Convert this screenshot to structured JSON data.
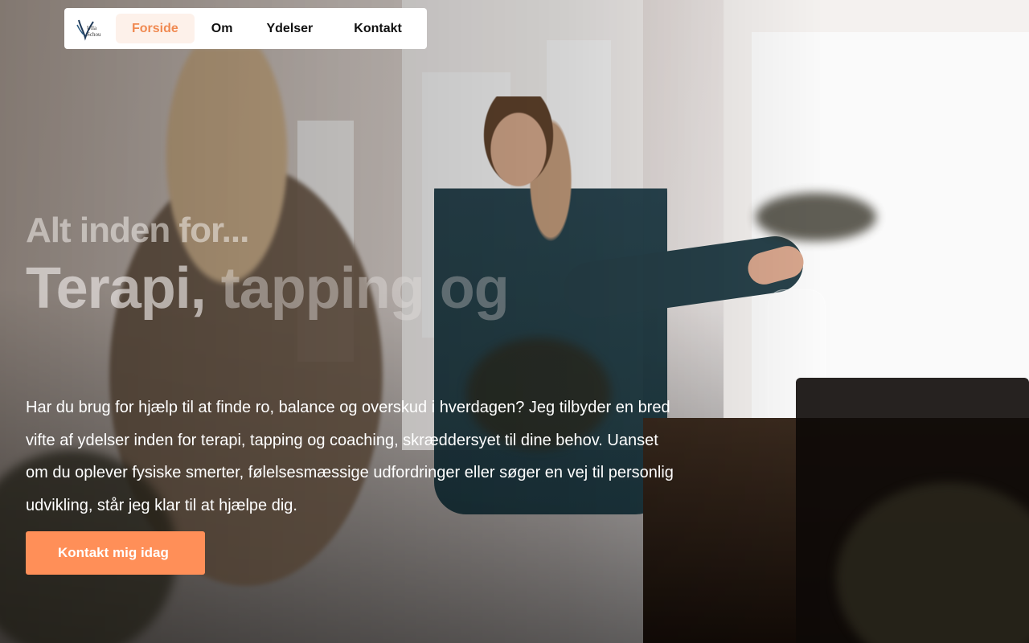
{
  "nav": {
    "logo_text": "Ulla Schou",
    "items": [
      {
        "label": "Forside",
        "active": true
      },
      {
        "label": "Om",
        "active": false
      },
      {
        "label": "Ydelser",
        "active": false
      },
      {
        "label": "Kontakt",
        "active": false
      }
    ]
  },
  "hero": {
    "kicker": "Alt inden for...",
    "headline_part1": "Terapi,",
    "headline_part2": "tapping",
    "headline_part3": "og",
    "body": "Har du brug for hjælp til at finde ro, balance og overskud i hverdagen? Jeg tilbyder en bred vifte af ydelser inden for terapi, tapping og coaching, skræddersyet til dine behov. Uanset om du oplever fysiske smerter, følelsesmæssige udfordringer eller søger en vej til personlig udvikling, står jeg klar til at hjælpe dig.",
    "cta_label": "Kontakt mig idag"
  },
  "colors": {
    "accent": "#ff8f58",
    "nav_active_text": "#f08a52",
    "nav_active_bg": "#fdf1ea"
  }
}
